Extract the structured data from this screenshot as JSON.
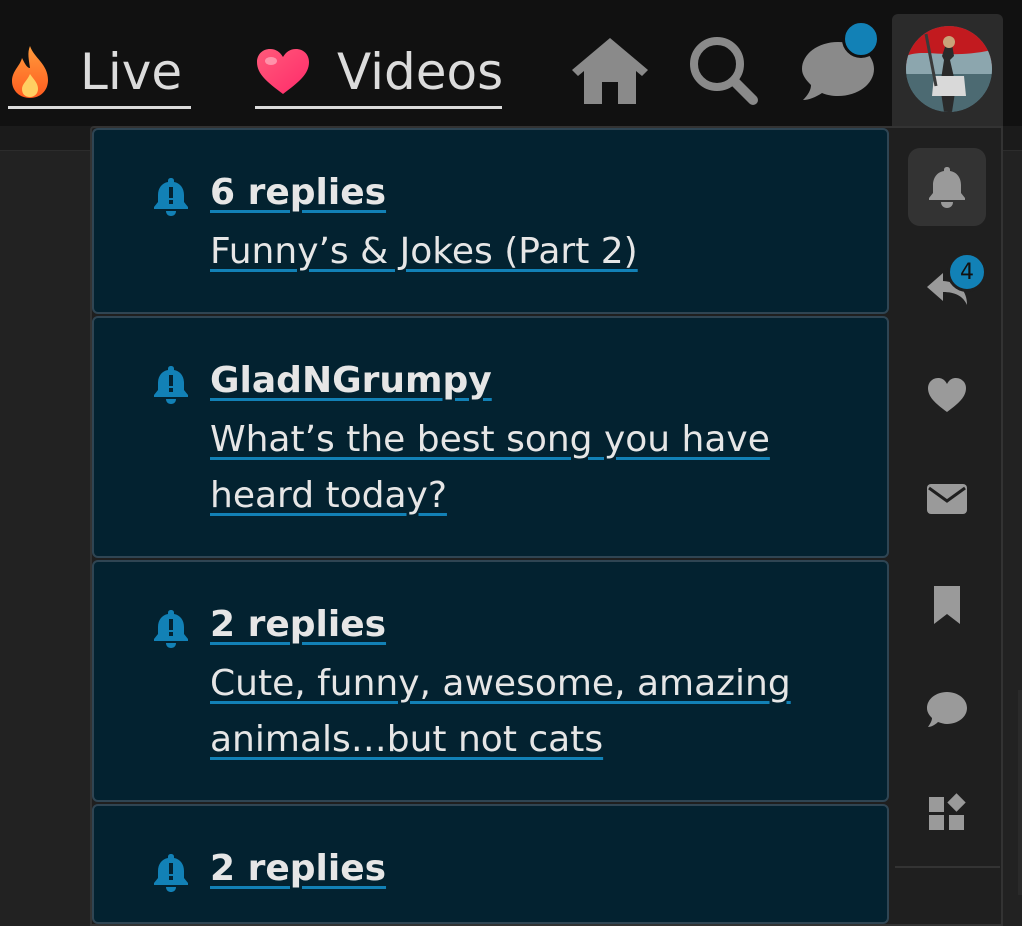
{
  "nav": {
    "live_label": "Live",
    "videos_label": "Videos",
    "live_icon": "fire-icon",
    "videos_icon": "heart-icon"
  },
  "header_icons": [
    "home-icon",
    "search-icon",
    "chat-icon",
    "avatar"
  ],
  "colors": {
    "accent": "#1281b6",
    "notification_bg": "#032230",
    "header_bg": "#111111",
    "panel_bg": "#1f1f1f"
  },
  "notifications": [
    {
      "title": "6 replies",
      "body": "Funny’s & Jokes (Part 2)"
    },
    {
      "title": "GladNGrumpy",
      "body": "What’s the best song you have heard today?"
    },
    {
      "title": "2 replies",
      "body": "Cute, funny, awesome, amazing animals…but not cats"
    },
    {
      "title": "2 replies",
      "body": ""
    }
  ],
  "sidebar": {
    "items": [
      "bell-icon",
      "reply-icon",
      "heart-icon",
      "mail-icon",
      "bookmark-icon",
      "chat-icon",
      "widgets-icon"
    ],
    "reply_badge": "4"
  }
}
